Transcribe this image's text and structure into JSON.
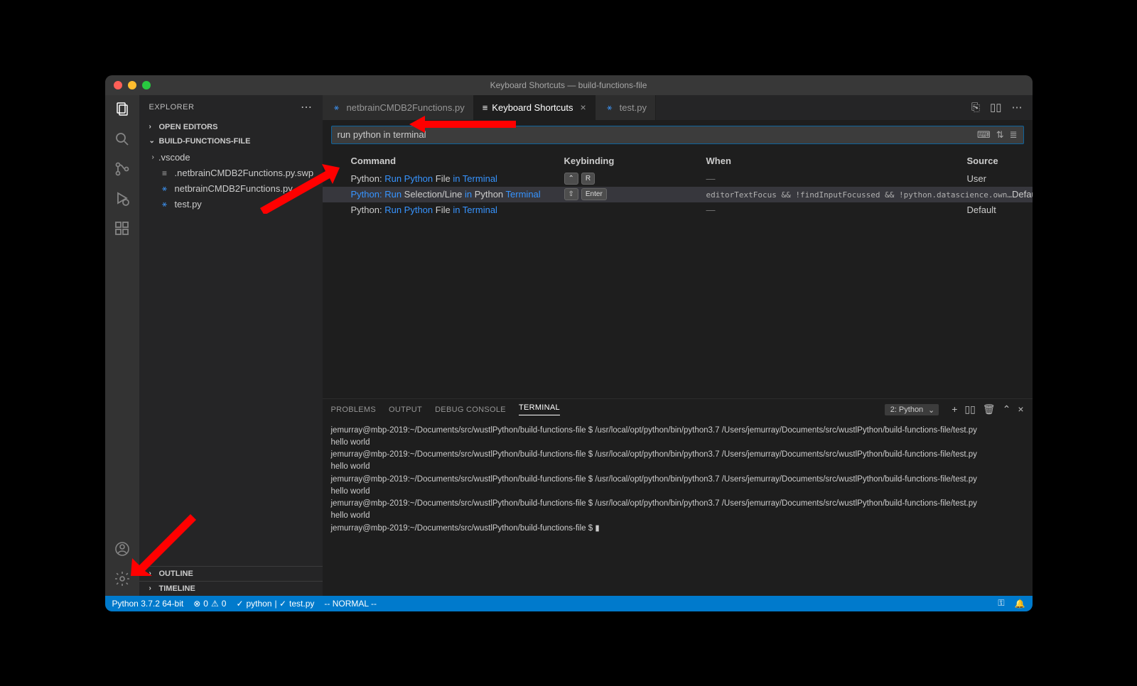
{
  "window_title": "Keyboard Shortcuts — build-functions-file",
  "sidebar": {
    "title": "EXPLORER",
    "open_editors": "OPEN EDITORS",
    "root_folder": "BUILD-FUNCTIONS-FILE",
    "files": {
      "vscode": ".vscode",
      "swp": ".netbrainCMDB2Functions.py.swp",
      "main_py": "netbrainCMDB2Functions.py",
      "test_py": "test.py"
    },
    "outline": "OUTLINE",
    "timeline": "TIMELINE"
  },
  "tabs": {
    "t1": "netbrainCMDB2Functions.py",
    "t2": "Keyboard Shortcuts",
    "t3": "test.py"
  },
  "search_value": "run python in terminal",
  "columns": {
    "command": "Command",
    "keybinding": "Keybinding",
    "when": "When",
    "source": "Source"
  },
  "rows": [
    {
      "prefix": "Python: ",
      "p1": "Run Python",
      "p1hl": true,
      "mid": " File ",
      "p2": "in Terminal",
      "p2hl": true,
      "key1": "⌃",
      "key2": "R",
      "when": "—",
      "source": "User"
    },
    {
      "prefix": "",
      "p1": "Python: Run",
      "p1hl": true,
      "mid": " Selection/Line ",
      "mid2": "in",
      "mid2hl": true,
      "mid3": " Python ",
      "p2": "Terminal",
      "p2hl": true,
      "key1": "⇧",
      "key2": "Enter",
      "when": "editorTextFocus && !findInputFocussed && !python.datascience.own…",
      "source": "Default"
    },
    {
      "prefix": "Python: ",
      "p1": "Run Python",
      "p1hl": true,
      "mid": " File ",
      "p2": "in Terminal",
      "p2hl": true,
      "when": "—",
      "source": "Default"
    }
  ],
  "panel": {
    "tabs": {
      "problems": "PROBLEMS",
      "output": "OUTPUT",
      "debug": "DEBUG CONSOLE",
      "terminal": "TERMINAL"
    },
    "dropdown": "2: Python"
  },
  "terminal_lines": [
    "jemurray@mbp-2019:~/Documents/src/wustlPython/build-functions-file $ /usr/local/opt/python/bin/python3.7 /Users/jemurray/Documents/src/wustlPython/build-functions-file/test.py",
    "hello world",
    "jemurray@mbp-2019:~/Documents/src/wustlPython/build-functions-file $ /usr/local/opt/python/bin/python3.7 /Users/jemurray/Documents/src/wustlPython/build-functions-file/test.py",
    "hello world",
    "jemurray@mbp-2019:~/Documents/src/wustlPython/build-functions-file $ /usr/local/opt/python/bin/python3.7 /Users/jemurray/Documents/src/wustlPython/build-functions-file/test.py",
    "hello world",
    "jemurray@mbp-2019:~/Documents/src/wustlPython/build-functions-file $ /usr/local/opt/python/bin/python3.7 /Users/jemurray/Documents/src/wustlPython/build-functions-file/test.py",
    "hello world",
    "jemurray@mbp-2019:~/Documents/src/wustlPython/build-functions-file $ ▮"
  ],
  "statusbar": {
    "python": "Python 3.7.2 64-bit",
    "errors": "0",
    "warnings": "0",
    "lint1": "python",
    "lint2": "test.py",
    "mode": "-- NORMAL --"
  }
}
